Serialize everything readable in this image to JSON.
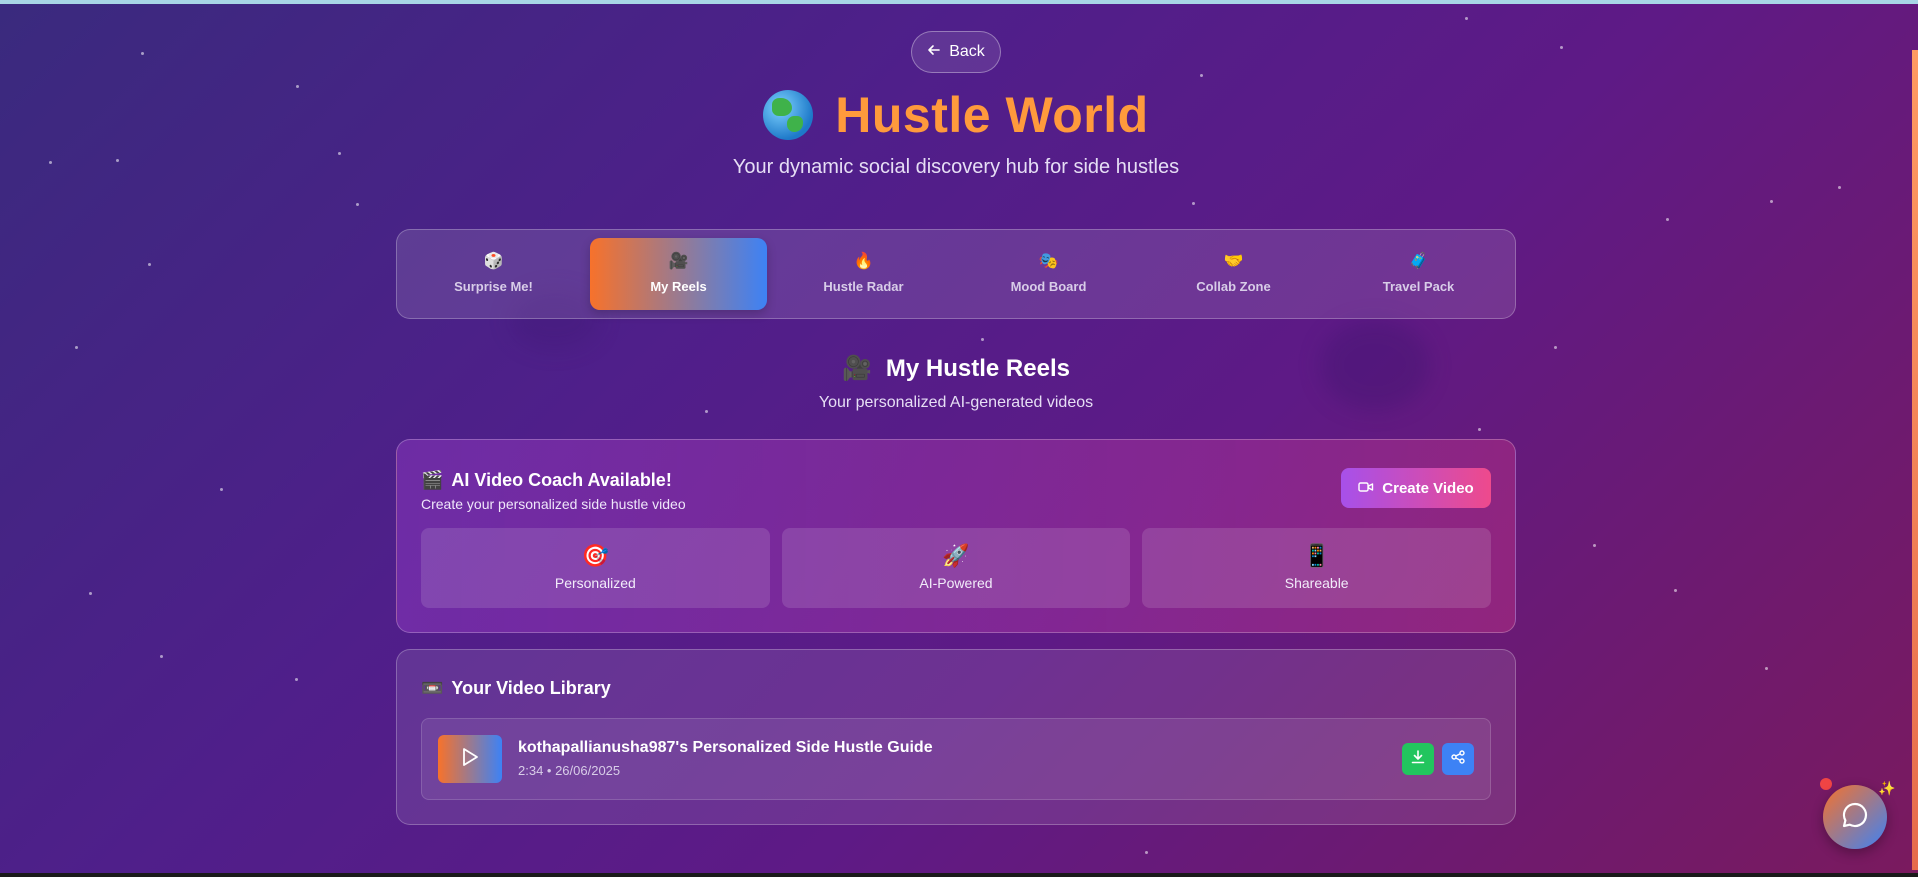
{
  "header": {
    "back_label": "Back",
    "title": "Hustle World",
    "subtitle": "Your dynamic social discovery hub for side hustles"
  },
  "tabs": [
    {
      "label": "Surprise Me!",
      "icon": "🎲",
      "active": false
    },
    {
      "label": "My Reels",
      "icon": "🎥",
      "active": true
    },
    {
      "label": "Hustle Radar",
      "icon": "🔥",
      "active": false
    },
    {
      "label": "Mood Board",
      "icon": "🎭",
      "active": false
    },
    {
      "label": "Collab Zone",
      "icon": "🤝",
      "active": false
    },
    {
      "label": "Travel Pack",
      "icon": "🧳",
      "active": false
    }
  ],
  "section": {
    "icon": "🎥",
    "title": "My Hustle Reels",
    "subtitle": "Your personalized AI-generated videos"
  },
  "coach": {
    "icon": "🎬",
    "title": "AI Video Coach Available!",
    "subtitle": "Create your personalized side hustle video",
    "create_label": "Create Video",
    "features": [
      {
        "icon": "🎯",
        "label": "Personalized"
      },
      {
        "icon": "🚀",
        "label": "AI-Powered"
      },
      {
        "icon": "📱",
        "label": "Shareable"
      }
    ]
  },
  "library": {
    "icon": "📼",
    "title": "Your Video Library",
    "videos": [
      {
        "title": "kothapallianusha987's Personalized Side Hustle Guide",
        "meta": "2:34 • 26/06/2025"
      }
    ]
  },
  "colors": {
    "title_orange": "#ff9a3c",
    "active_tab_start": "#f7722b",
    "active_tab_end": "#3d82f5",
    "create_start": "#a750ea",
    "create_end": "#ee4a8c",
    "download_green": "#22c55e",
    "share_blue": "#3d82f5"
  }
}
